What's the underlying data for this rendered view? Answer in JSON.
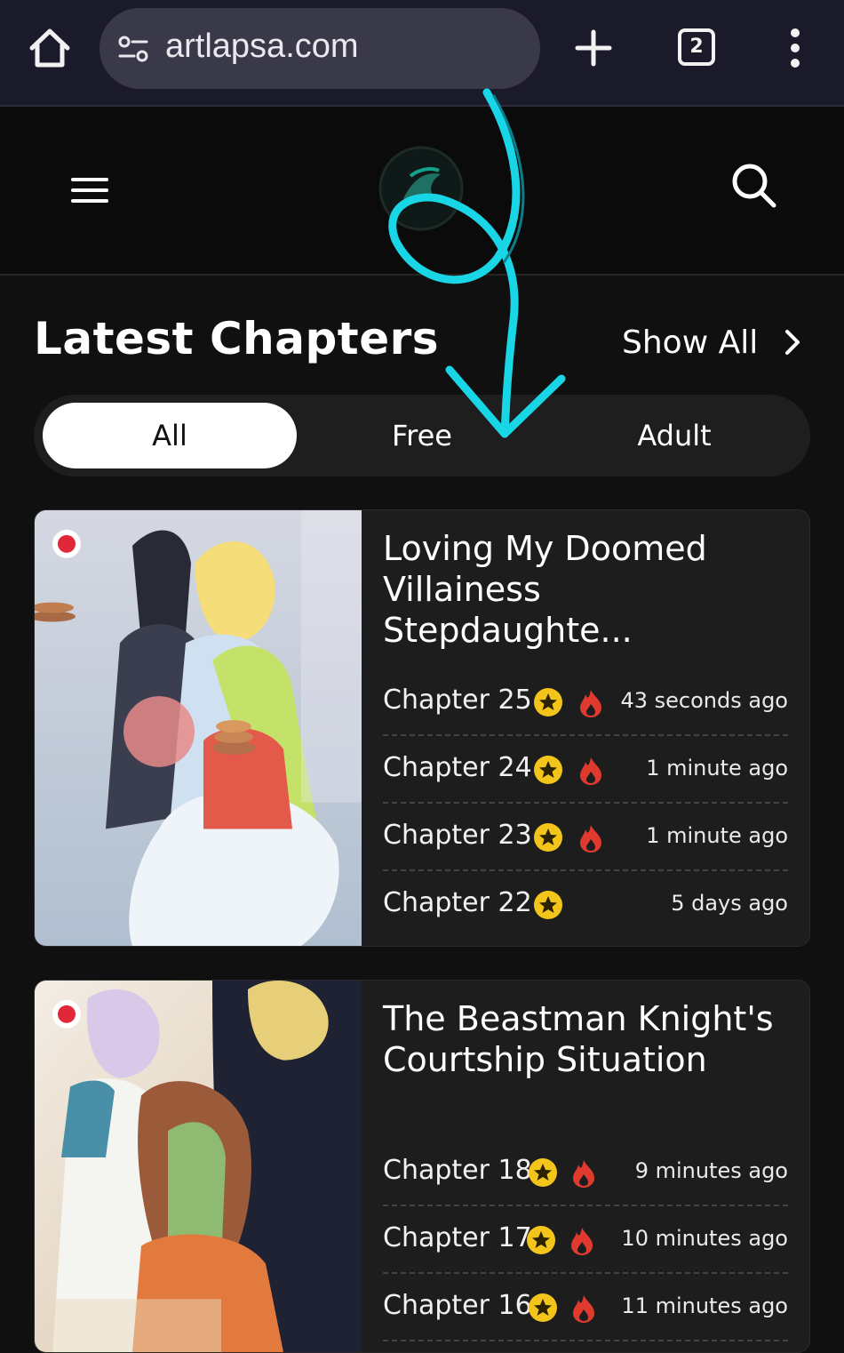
{
  "browser": {
    "url": "artlapsa.com",
    "tab_count": "2",
    "icons": [
      "home-icon",
      "site-settings-icon",
      "new-tab-plus-icon",
      "tab-switcher-icon",
      "more-vert-icon"
    ]
  },
  "header": {
    "icons": [
      "hamburger-menu-icon",
      "site-logo",
      "search-icon"
    ]
  },
  "section": {
    "title": "Latest Chapters",
    "show_all": "Show All"
  },
  "tabs": [
    {
      "label": "All",
      "active": true
    },
    {
      "label": "Free",
      "active": false
    },
    {
      "label": "Adult",
      "active": false
    }
  ],
  "series": [
    {
      "title": "Loving My Doomed Villainess Stepdaughte...",
      "chapters": [
        {
          "name": "Chapter 25",
          "time": "43 seconds ago",
          "star": true,
          "hot": true
        },
        {
          "name": "Chapter 24",
          "time": "1 minute ago",
          "star": true,
          "hot": true
        },
        {
          "name": "Chapter 23",
          "time": "1 minute ago",
          "star": true,
          "hot": true
        },
        {
          "name": "Chapter 22",
          "time": "5 days ago",
          "star": true,
          "hot": false
        }
      ]
    },
    {
      "title": "The Beastman Knight's Courtship Situation",
      "chapters": [
        {
          "name": "Chapter 18",
          "time": "9 minutes ago",
          "star": true,
          "hot": true
        },
        {
          "name": "Chapter 17",
          "time": "10 minutes ago",
          "star": true,
          "hot": true
        },
        {
          "name": "Chapter 16",
          "time": "11 minutes ago",
          "star": true,
          "hot": true
        }
      ]
    }
  ],
  "colors": {
    "accent_arrow": "#19d6e6",
    "star": "#f3c51a",
    "fire": "#e03a2f",
    "background": "#101010",
    "card": "#1d1d1d"
  }
}
